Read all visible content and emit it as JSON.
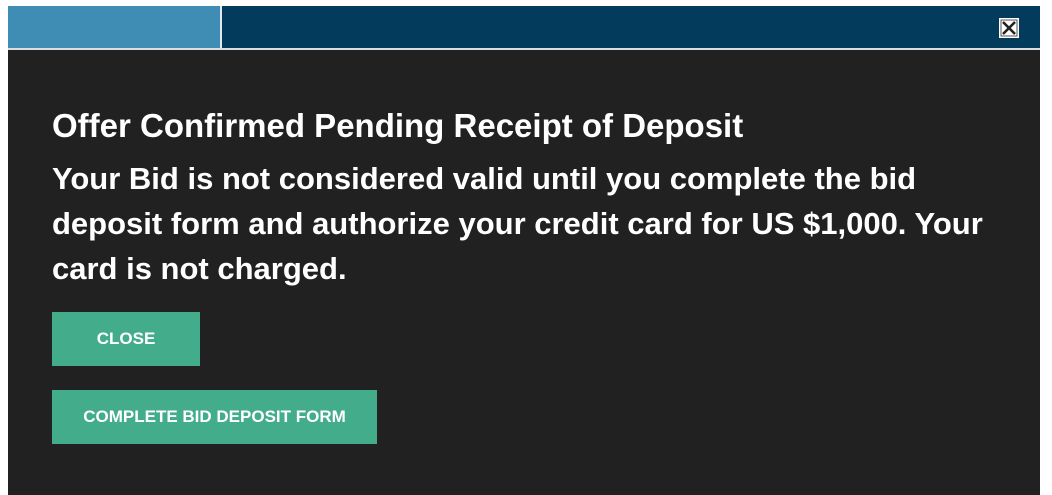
{
  "tabs": [
    {
      "label": ""
    },
    {
      "label": ""
    }
  ],
  "header": {
    "close_icon": "close-box-icon"
  },
  "dialog": {
    "title": "Offer Confirmed Pending Receipt of Deposit",
    "message": "Your Bid is not considered valid until you complete the bid deposit form and authorize your credit card for US $1,000. Your card is not charged."
  },
  "buttons": {
    "close_label": "CLOSE",
    "deposit_label": "COMPLETE BID DEPOSIT FORM"
  },
  "colors": {
    "background": "#212121",
    "tabbar": "#023b5c",
    "tab_active": "#3f8db5",
    "button": "#43ad8b",
    "text": "#ffffff"
  }
}
